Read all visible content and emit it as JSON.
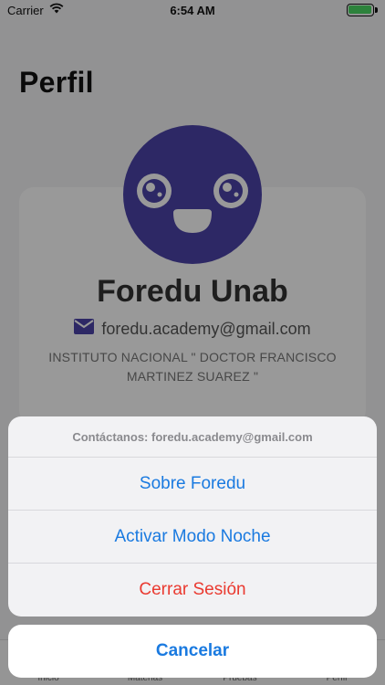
{
  "status_bar": {
    "carrier": "Carrier",
    "time": "6:54 AM"
  },
  "page": {
    "title": "Perfil"
  },
  "profile": {
    "name": "Foredu Unab",
    "email": "foredu.academy@gmail.com",
    "institute": "INSTITUTO NACIONAL \" DOCTOR FRANCISCO MARTINEZ SUAREZ \"",
    "avatar_color": "#4b43a8"
  },
  "tabs": [
    {
      "label": "Inicio"
    },
    {
      "label": "Materias"
    },
    {
      "label": "Pruebas"
    },
    {
      "label": "Perfil"
    }
  ],
  "action_sheet": {
    "title": "Contáctanos: foredu.academy@gmail.com",
    "actions": [
      {
        "label": "Sobre Foredu"
      },
      {
        "label": "Activar Modo Noche"
      },
      {
        "label": "Cerrar Sesión"
      }
    ],
    "cancel": "Cancelar"
  },
  "colors": {
    "accent": "#1a7ae0",
    "destructive": "#ea3a30"
  }
}
